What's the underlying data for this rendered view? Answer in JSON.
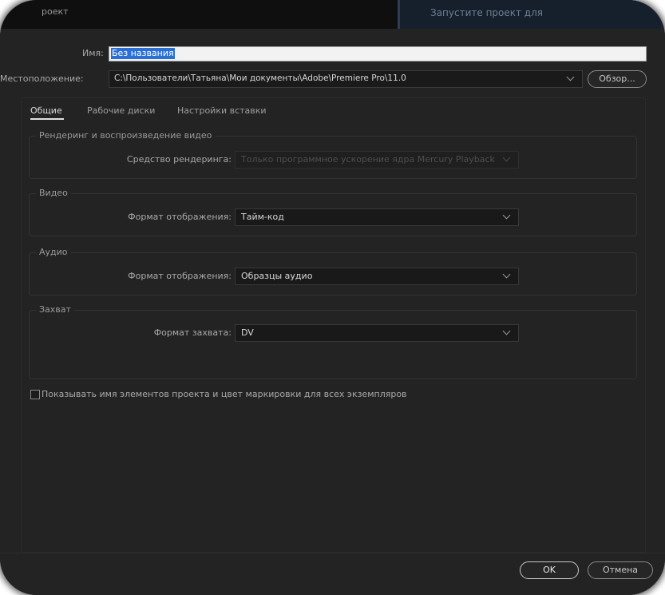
{
  "window": {
    "title": "роект",
    "background_title": "Запустите проект для"
  },
  "name": {
    "label": "Имя:",
    "value": "Без названия"
  },
  "location": {
    "label": "Местоположение:",
    "path": "C:\\Пользователи\\Татьяна\\Мои документы\\Adobe\\Premiere Pro\\11.0",
    "browse_label": "Обзор..."
  },
  "tabs": [
    {
      "label": "Общие",
      "active": true
    },
    {
      "label": "Рабочие диски",
      "active": false
    },
    {
      "label": "Настройки вставки",
      "active": false
    }
  ],
  "groups": {
    "render": {
      "title": "Рендеринг и воспроизведение видео",
      "field_label": "Средство рендеринга:",
      "value": "Только программное ускорение ядра Mercury Playback",
      "disabled": true
    },
    "video": {
      "title": "Видео",
      "field_label": "Формат отображения:",
      "value": "Тайм-код"
    },
    "audio": {
      "title": "Аудио",
      "field_label": "Формат отображения:",
      "value": "Образцы аудио"
    },
    "capture": {
      "title": "Захват",
      "field_label": "Формат захвата:",
      "value": "DV"
    }
  },
  "checkbox": {
    "label": "Показывать имя элементов проекта и цвет маркировки для всех экземпляров",
    "checked": false
  },
  "buttons": {
    "ok": "OK",
    "cancel": "Отмена"
  },
  "colors": {
    "dialog_bg": "#232323",
    "selection": "#2a6fd6"
  }
}
